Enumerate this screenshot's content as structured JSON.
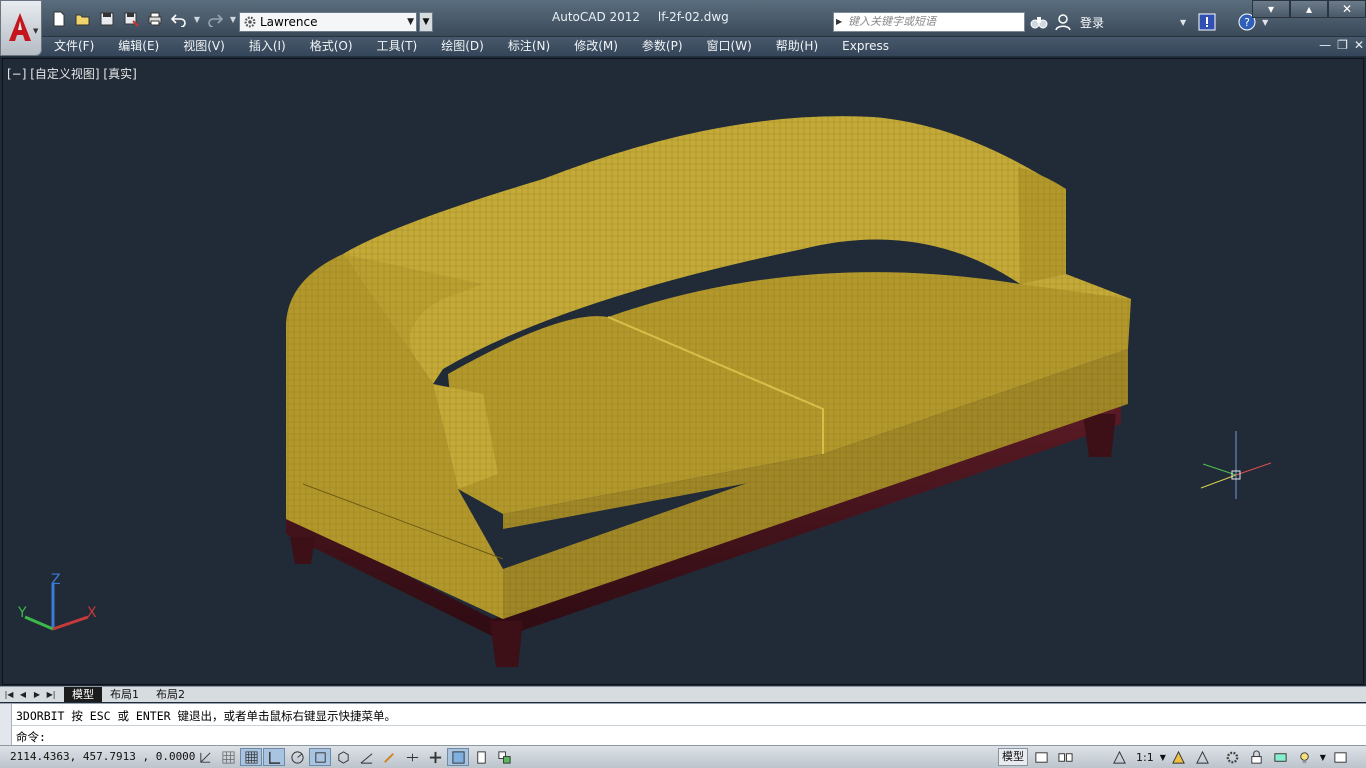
{
  "app": {
    "name": "AutoCAD 2012",
    "file": "lf-2f-02.dwg"
  },
  "quick_access": {
    "icons": [
      "new-icon",
      "open-icon",
      "save-icon",
      "save-as-icon",
      "plot-icon",
      "undo-icon",
      "redo-icon"
    ],
    "workspace": "Lawrence"
  },
  "search": {
    "placeholder": "键入关键字或短语"
  },
  "user": {
    "login_label": "登录"
  },
  "menu": {
    "items": [
      "文件(F)",
      "编辑(E)",
      "视图(V)",
      "插入(I)",
      "格式(O)",
      "工具(T)",
      "绘图(D)",
      "标注(N)",
      "修改(M)",
      "参数(P)",
      "窗口(W)",
      "帮助(H)",
      "Express"
    ]
  },
  "viewport": {
    "label": "[−] [自定义视图] [真实]",
    "ucs": {
      "x": "X",
      "y": "Y",
      "z": "Z"
    },
    "colors": {
      "background": "#212a37",
      "fabric": "#b59a2c",
      "base": "#4a1520"
    }
  },
  "layout_tabs": {
    "items": [
      "模型",
      "布局1",
      "布局2"
    ],
    "active": "模型"
  },
  "command": {
    "history": "3DORBIT 按 ESC 或 ENTER 键退出，或者单击鼠标右键显示快捷菜单。",
    "prompt": "命令:"
  },
  "status": {
    "coordinates": "2114.4363, 457.7913 , 0.0000",
    "model_label": "模型",
    "annotation_scale": "1:1"
  }
}
